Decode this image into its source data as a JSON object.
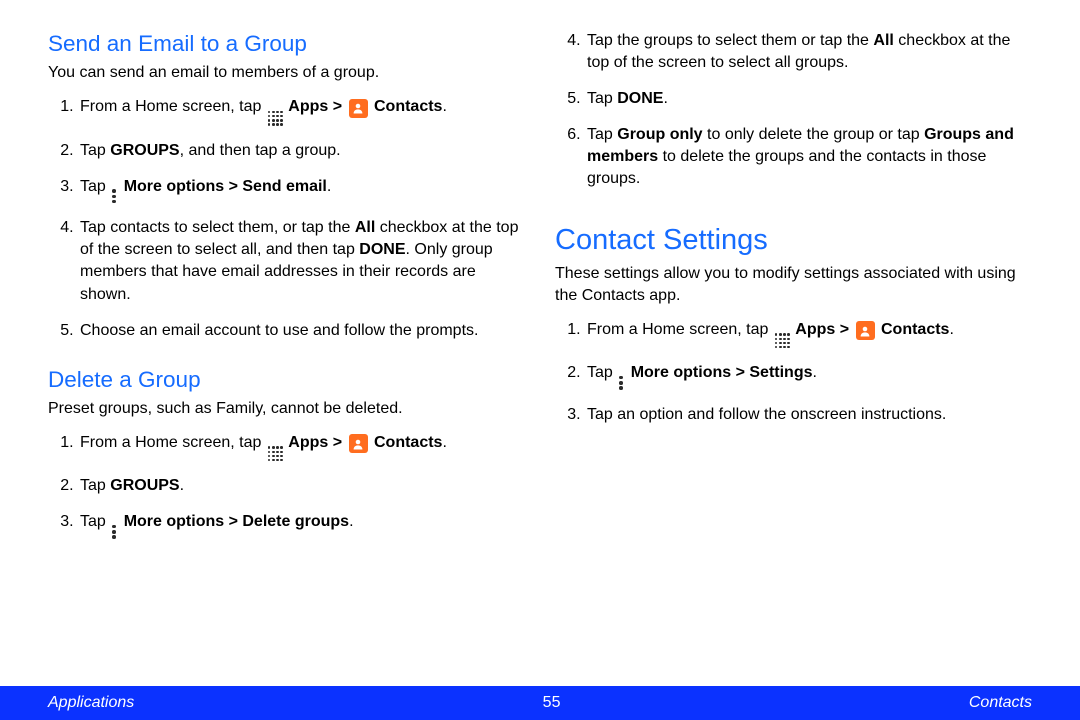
{
  "left": {
    "section1": {
      "heading": "Send an Email to a Group",
      "intro": "You can send an email to members of a group.",
      "step1a": "From a Home screen, tap ",
      "step1b_apps": "Apps > ",
      "step1c_contacts": "Contacts",
      "step1d": ".",
      "step2a": "Tap ",
      "step2b": "GROUPS",
      "step2c": ", and then tap a group.",
      "step3a": "Tap ",
      "step3b": "More options > Send email",
      "step3c": ".",
      "step4a": "Tap contacts to select them, or tap the ",
      "step4b": "All",
      "step4c": " checkbox at the top of the screen to select all, and then tap ",
      "step4d": "DONE",
      "step4e": ". Only group members that have email addresses in their records are shown.",
      "step5": "Choose an email account to use and follow the prompts."
    },
    "section2": {
      "heading": "Delete a Group",
      "intro": "Preset groups, such as Family, cannot be deleted.",
      "step1a": "From a Home screen, tap ",
      "step1b_apps": "Apps > ",
      "step1c_contacts": "Contacts",
      "step1d": ".",
      "step2a": "Tap ",
      "step2b": "GROUPS",
      "step2c": ".",
      "step3a": "Tap ",
      "step3b": "More options > Delete groups",
      "step3c": "."
    }
  },
  "right": {
    "cont": {
      "step4a": "Tap the groups to select them or tap the ",
      "step4b": "All",
      "step4c": " checkbox at the top of the screen to select all groups.",
      "step5a": "Tap ",
      "step5b": "DONE",
      "step5c": ".",
      "step6a": "Tap ",
      "step6b": "Group only",
      "step6c": " to only delete the group or tap ",
      "step6d": "Groups and members",
      "step6e": " to delete the groups and the contacts in those groups."
    },
    "section3": {
      "heading": "Contact Settings",
      "intro": "These settings allow you to modify settings associated with using the Contacts app.",
      "step1a": "From a Home screen, tap ",
      "step1b_apps": "Apps > ",
      "step1c_contacts": "Contacts",
      "step1d": ".",
      "step2a": "Tap ",
      "step2b": "More options > Settings",
      "step2c": ".",
      "step3": "Tap an option and follow the onscreen instructions."
    }
  },
  "footer": {
    "left": "Applications",
    "center": "55",
    "right": "Contacts"
  },
  "colors": {
    "heading": "#166cff",
    "footer_bg": "#0b32ff",
    "icon_orange": "#ff6d1f"
  }
}
